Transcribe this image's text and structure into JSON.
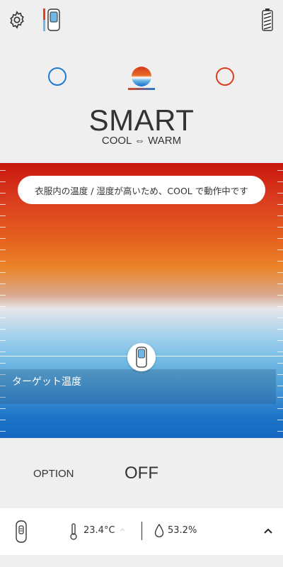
{
  "header": {
    "icons": [
      "gear-icon",
      "device-icon",
      "battery-icon"
    ]
  },
  "modes": [
    {
      "name": "cool",
      "color": "#1f7bd1"
    },
    {
      "name": "smart",
      "selected": true
    },
    {
      "name": "warm",
      "color": "#d8401e"
    }
  ],
  "mode_title": "SMART",
  "mode_subtitle": "COOL ⇔ WARM",
  "status_message": "衣服内の温度 / 湿度が高いため、COOL で動作中です",
  "target_label": "ターゲット温度",
  "option": {
    "label": "OPTION",
    "value": "OFF"
  },
  "bottom_bar": {
    "temperature": "23.4°C",
    "humidity": "53.2%"
  },
  "colors": {
    "warm_top": "#c8160d",
    "cool_bottom": "#1467c1",
    "accent_blue": "#1f7bd1",
    "accent_red": "#d8401e"
  }
}
